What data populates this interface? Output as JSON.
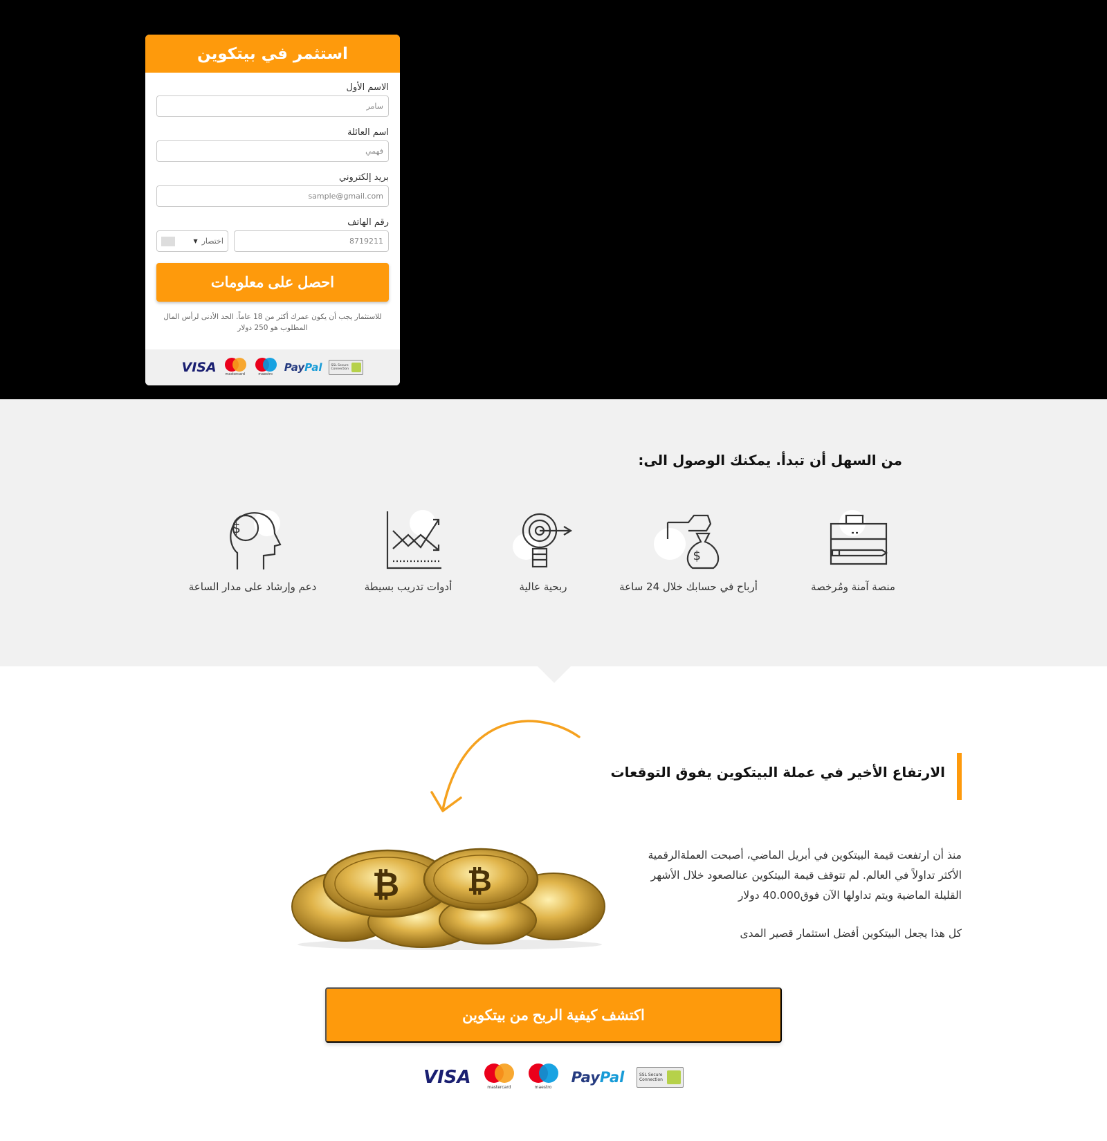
{
  "form": {
    "title": "استثمر في بيتكوين",
    "first_name_label": "الاسم الأول",
    "first_name_placeholder": "سامر",
    "last_name_label": "اسم العائلة",
    "last_name_placeholder": "فهمي",
    "email_label": "بريد إلكتروني",
    "email_placeholder": "sample@gmail.com",
    "phone_label": "رقم الهاتف",
    "phone_placeholder": "8719211",
    "country_code_value": "اختصار",
    "submit_label": "احصل على معلومات",
    "disclaimer": "للاستثمار يجب أن يكون عمرك أكثر من 18 عاماً. الحد الأدنى لرأس المال المطلوب هو 250 دولار"
  },
  "payment_logos": {
    "visa": "VISA",
    "mastercard": "mastercard",
    "maestro": "maestro",
    "paypal_pay": "Pay",
    "paypal_pal": "Pal",
    "ssl": "SSL Secure Connection",
    "icons": [
      "visa-logo",
      "mastercard-logo",
      "maestro-logo",
      "paypal-logo",
      "ssl-badge"
    ]
  },
  "features": {
    "title": "من السهل أن تبدأ. يمكنك الوصول الى:",
    "items": [
      {
        "label": "منصة آمنة ومُرخصة",
        "icon": "briefcase-icon"
      },
      {
        "label": "أرباح في حسابك خلال 24 ساعة",
        "icon": "money-bag-icon"
      },
      {
        "label": "ربحية عالية",
        "icon": "lightbulb-target-icon"
      },
      {
        "label": "أدوات تدريب بسيطة",
        "icon": "trading-chart-icon"
      },
      {
        "label": "دعم وإرشاد على مدار الساعة",
        "icon": "head-dollar-icon"
      }
    ]
  },
  "article": {
    "title": "الارتفاع الأخير في عملة البيتكوين يفوق التوقعات",
    "paragraph1": "منذ أن ارتفعت قيمة البيتكوين في أبريل الماضي، أصبحت العملةالرقمية الأكثر تداولاً في العالم. لم تتوقف قيمة البيتكوين عنالصعود خلال الأشهر القليلة الماضية ويتم تداولها الآن فوق40.000 دولار",
    "paragraph2": "كل هذا يجعل البيتكوين أفضل استثمار قصير المدى"
  },
  "cta": {
    "label": "اكتشف كيفية الربح من بيتكوين"
  },
  "colors": {
    "accent": "#fe9a0c",
    "hero_bg": "#000000",
    "features_bg": "#f1f1f1"
  }
}
